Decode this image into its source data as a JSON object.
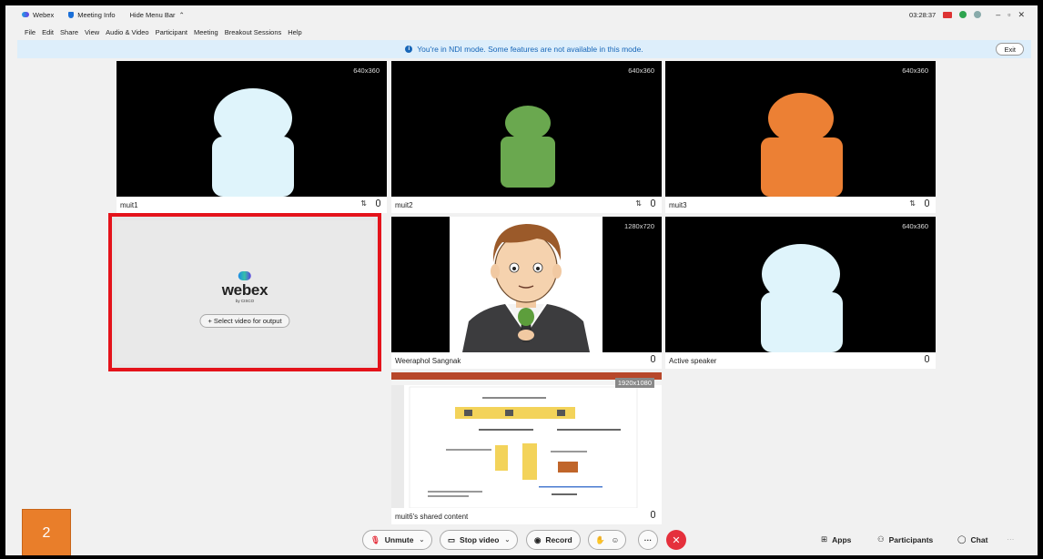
{
  "titlebar": {
    "app": "Webex",
    "meeting_info": "Meeting Info",
    "hide_menu": "Hide Menu Bar",
    "time": "03:28:37",
    "minimize": "–",
    "restore": "▫",
    "close": "✕"
  },
  "menu": [
    "File",
    "Edit",
    "Share",
    "View",
    "Audio & Video",
    "Participant",
    "Meeting",
    "Breakout Sessions",
    "Help"
  ],
  "banner": {
    "text": "You're in NDI mode. Some features are not available in this mode.",
    "exit": "Exit"
  },
  "tiles": [
    {
      "name": "muit1",
      "resolution": "640x360",
      "color": "#dff4fb"
    },
    {
      "name": "muit2",
      "resolution": "640x360",
      "color": "#6aa84f"
    },
    {
      "name": "muit3",
      "resolution": "640x360",
      "color": "#ec8034"
    },
    {
      "name": "Weeraphol Sangnak",
      "resolution": "1280x720"
    },
    {
      "name": "Active speaker",
      "resolution": "640x360",
      "color": "#dff4fb"
    },
    {
      "name": "muit6's shared content",
      "resolution": "1920x1080"
    }
  ],
  "placeholder": {
    "brand": "webex",
    "sub": "by CISCO",
    "button": "+ Select video for output"
  },
  "toolbar": {
    "unmute": "Unmute",
    "stop_video": "Stop video",
    "record": "Record",
    "more": "···",
    "end": "✕",
    "apps": "Apps",
    "participants": "Participants",
    "chat": "Chat",
    "overflow": "···"
  },
  "overlay_badge": "2",
  "colors": {
    "accent": "#1766b8",
    "highlight": "#e4131b",
    "end_call": "#e5303c",
    "badge": "#e97e2a"
  }
}
